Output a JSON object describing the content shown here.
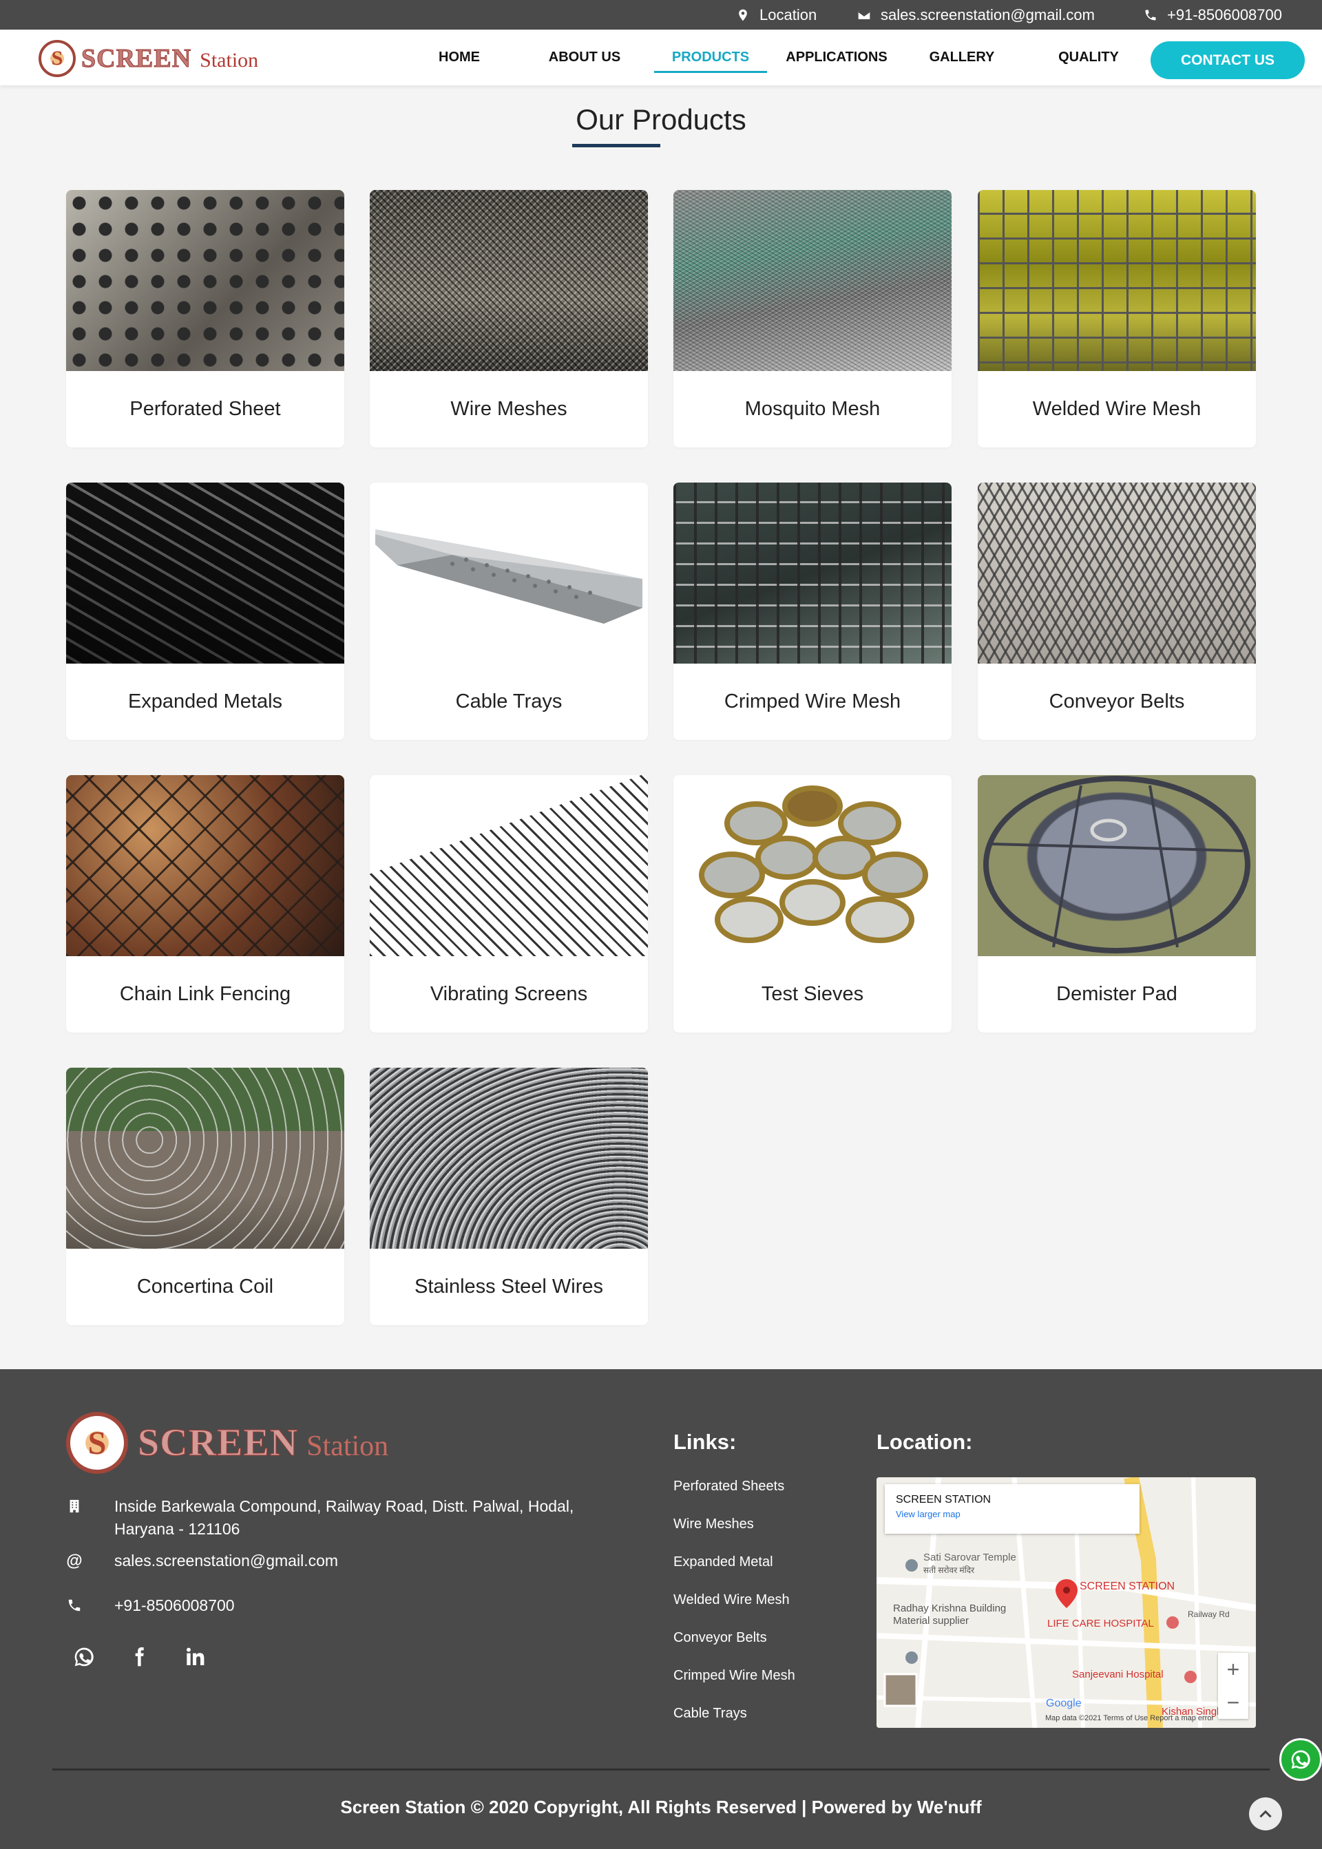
{
  "topbar": {
    "location": "Location",
    "email": "sales.screenstation@gmail.com",
    "phone": "+91-8506008700"
  },
  "brand": {
    "mark": "S",
    "name_big": "SCREEN",
    "name_small": "Station"
  },
  "nav": {
    "items": [
      {
        "label": "HOME"
      },
      {
        "label": "ABOUT US"
      },
      {
        "label": "PRODUCTS"
      },
      {
        "label": "APPLICATIONS"
      },
      {
        "label": "GALLERY"
      },
      {
        "label": "QUALITY"
      }
    ],
    "active": "PRODUCTS",
    "contact_label": "CONTACT US",
    "accent_color": "#16bfd0"
  },
  "products_section": {
    "title": "Our Products",
    "items": [
      {
        "label": "Perforated Sheet"
      },
      {
        "label": "Wire Meshes"
      },
      {
        "label": "Mosquito Mesh"
      },
      {
        "label": "Welded Wire Mesh"
      },
      {
        "label": "Expanded Metals"
      },
      {
        "label": "Cable Trays"
      },
      {
        "label": "Crimped Wire Mesh"
      },
      {
        "label": "Conveyor Belts"
      },
      {
        "label": "Chain Link Fencing"
      },
      {
        "label": "Vibrating Screens"
      },
      {
        "label": "Test Sieves"
      },
      {
        "label": "Demister Pad"
      },
      {
        "label": "Concertina Coil"
      },
      {
        "label": "Stainless Steel Wires"
      }
    ]
  },
  "footer": {
    "address": "Inside Barkewala Compound, Railway Road, Distt. Palwal, Hodal, Haryana - 121106",
    "email": "sales.screenstation@gmail.com",
    "phone": "+91-8506008700",
    "links_heading": "Links:",
    "links": [
      {
        "label": "Perforated Sheets"
      },
      {
        "label": "Wire Meshes"
      },
      {
        "label": "Expanded Metal"
      },
      {
        "label": "Welded Wire Mesh"
      },
      {
        "label": "Conveyor Belts"
      },
      {
        "label": "Crimped Wire Mesh"
      },
      {
        "label": "Cable Trays"
      }
    ],
    "location_heading": "Location:",
    "map": {
      "card_title": "SCREEN STATION",
      "card_link": "View larger map",
      "pin_label": "SCREEN STATION",
      "places": [
        {
          "label": "Sati Sarovar Temple"
        },
        {
          "label": "सती सरोवर मंदिर"
        },
        {
          "label": "Radhay Krishna Building"
        },
        {
          "label": "Material supplier"
        },
        {
          "label": "LIFE CARE HOSPITAL"
        },
        {
          "label": "Sanjeevani Hospital"
        },
        {
          "label": "Railway Rd"
        },
        {
          "label": "Kishan Singh Hos"
        }
      ],
      "attribution": "Google",
      "legal": "Map data ©2021   Terms of Use   Report a map error"
    },
    "copyright": "Screen Station © 2020 Copyright, All Rights Reserved | Powered by We'nuff"
  },
  "icons": {
    "topbar": [
      "location-pin-icon",
      "envelope-icon",
      "phone-icon"
    ],
    "social": [
      "whatsapp-icon",
      "facebook-icon",
      "linkedin-icon"
    ],
    "floating": [
      "whatsapp-icon",
      "chevron-up-icon"
    ]
  }
}
